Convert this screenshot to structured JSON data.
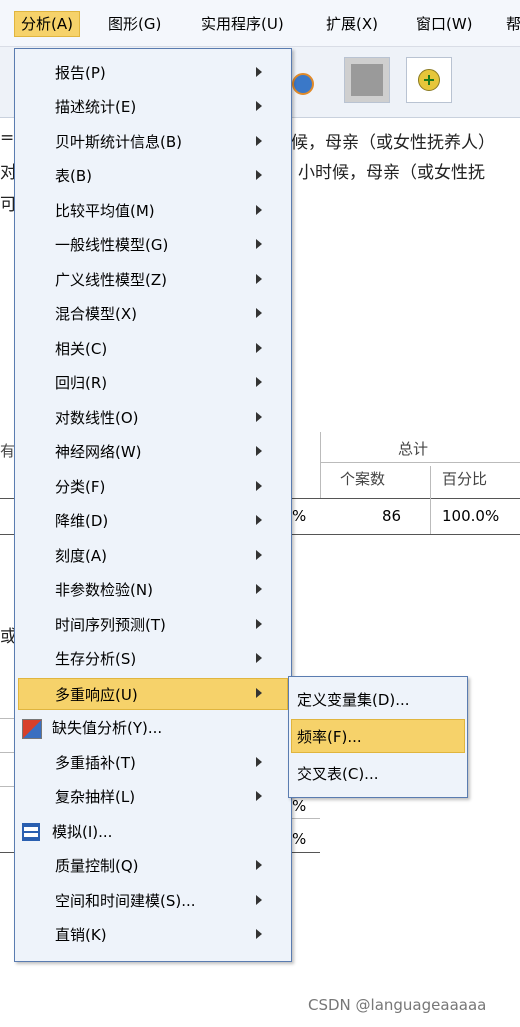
{
  "menubar": {
    "items": [
      {
        "label": "分析(A)"
      },
      {
        "label": "图形(G)"
      },
      {
        "label": "实用程序(U)"
      },
      {
        "label": "扩展(X)"
      },
      {
        "label": "窗口(W)"
      },
      {
        "label": "帮"
      }
    ]
  },
  "background": {
    "line1_left": "=",
    "line1_right": "候，母亲（或女性抚养人）",
    "line2_left": "对",
    "line2_right": "小时候，母亲（或女性抚",
    "line3_left": "可",
    "row_label": "有",
    "row_label2": "或",
    "total_header": "总计",
    "col_cases": "个案数",
    "col_percent": "百分比",
    "val_suffix": "%",
    "val_cases": "86",
    "val_percent": "100.0%",
    "pct_a": "%",
    "pct_b": "%"
  },
  "analyze_menu": {
    "items": [
      {
        "label": "报告(P)",
        "submenu": true
      },
      {
        "label": "描述统计(E)",
        "submenu": true
      },
      {
        "label": "贝叶斯统计信息(B)",
        "submenu": true
      },
      {
        "label": "表(B)",
        "submenu": true
      },
      {
        "label": "比较平均值(M)",
        "submenu": true
      },
      {
        "label": "一般线性模型(G)",
        "submenu": true
      },
      {
        "label": "广义线性模型(Z)",
        "submenu": true
      },
      {
        "label": "混合模型(X)",
        "submenu": true
      },
      {
        "label": "相关(C)",
        "submenu": true
      },
      {
        "label": "回归(R)",
        "submenu": true
      },
      {
        "label": "对数线性(O)",
        "submenu": true
      },
      {
        "label": "神经网络(W)",
        "submenu": true
      },
      {
        "label": "分类(F)",
        "submenu": true
      },
      {
        "label": "降维(D)",
        "submenu": true
      },
      {
        "label": "刻度(A)",
        "submenu": true
      },
      {
        "label": "非参数检验(N)",
        "submenu": true
      },
      {
        "label": "时间序列预测(T)",
        "submenu": true
      },
      {
        "label": "生存分析(S)",
        "submenu": true
      },
      {
        "label": "多重响应(U)",
        "submenu": true
      },
      {
        "label": "缺失值分析(Y)...",
        "submenu": false
      },
      {
        "label": "多重插补(T)",
        "submenu": true
      },
      {
        "label": "复杂抽样(L)",
        "submenu": true
      },
      {
        "label": "模拟(I)...",
        "submenu": false
      },
      {
        "label": "质量控制(Q)",
        "submenu": true
      },
      {
        "label": "空间和时间建模(S)...",
        "submenu": true
      },
      {
        "label": "直销(K)",
        "submenu": true
      }
    ]
  },
  "submenu": {
    "items": [
      {
        "label": "定义变量集(D)..."
      },
      {
        "label": "频率(F)..."
      },
      {
        "label": "交叉表(C)..."
      }
    ]
  },
  "watermark": "CSDN @languageaaaaa",
  "colors": {
    "highlight": "#f6d26a",
    "menu_bg": "#eef3fa",
    "menu_border": "#5a7cb0"
  }
}
